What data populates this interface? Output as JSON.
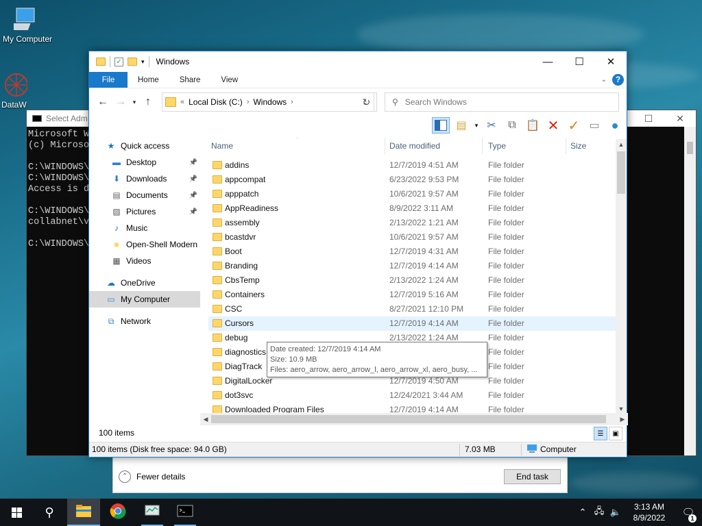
{
  "desktop": {
    "icons": [
      {
        "label": "My Computer",
        "icon": "computer-icon"
      },
      {
        "label": "DataW",
        "icon": "datawarehouse-icon"
      }
    ]
  },
  "cmd": {
    "title": "Select Adm",
    "lines": [
      "Microsoft W",
      "(c) Microso",
      "",
      "C:\\WINDOWS\\:",
      "C:\\WINDOWS\\:",
      "Access is de",
      "",
      "C:\\WINDOWS\\:",
      "collabnet\\v",
      "",
      "C:\\WINDOWS\\:"
    ]
  },
  "taskmgr": {
    "fewer_details": "Fewer details",
    "end_task": "End task"
  },
  "explorer": {
    "title": "Windows",
    "ribbon_tabs": [
      "File",
      "Home",
      "Share",
      "View"
    ],
    "address": {
      "root": "Local Disk (C:)",
      "current": "Windows",
      "prefix": "«"
    },
    "search_placeholder": "Search Windows",
    "columns": {
      "name": "Name",
      "date": "Date modified",
      "type": "Type",
      "size": "Size"
    },
    "nav": [
      {
        "label": "Quick access",
        "level": 0,
        "icon": "star-icon"
      },
      {
        "label": "Desktop",
        "level": 1,
        "icon": "desktop-icon",
        "pinned": true
      },
      {
        "label": "Downloads",
        "level": 1,
        "icon": "download-icon",
        "pinned": true
      },
      {
        "label": "Documents",
        "level": 1,
        "icon": "document-icon",
        "pinned": true
      },
      {
        "label": "Pictures",
        "level": 1,
        "icon": "pictures-icon",
        "pinned": true
      },
      {
        "label": "Music",
        "level": 1,
        "icon": "music-icon"
      },
      {
        "label": "Open-Shell Modern",
        "level": 1,
        "icon": "folder-icon"
      },
      {
        "label": "Videos",
        "level": 1,
        "icon": "video-icon"
      },
      {
        "label": "OneDrive",
        "level": 0,
        "icon": "cloud-icon"
      },
      {
        "label": "My Computer",
        "level": 0,
        "icon": "computer-icon",
        "selected": true
      },
      {
        "label": "Network",
        "level": 0,
        "icon": "network-icon"
      }
    ],
    "files": [
      {
        "name": "addins",
        "date": "12/7/2019 4:51 AM",
        "type": "File folder"
      },
      {
        "name": "appcompat",
        "date": "6/23/2022 9:53 PM",
        "type": "File folder"
      },
      {
        "name": "apppatch",
        "date": "10/6/2021 9:57 AM",
        "type": "File folder"
      },
      {
        "name": "AppReadiness",
        "date": "8/9/2022 3:11 AM",
        "type": "File folder"
      },
      {
        "name": "assembly",
        "date": "2/13/2022 1:21 AM",
        "type": "File folder"
      },
      {
        "name": "bcastdvr",
        "date": "10/6/2021 9:57 AM",
        "type": "File folder"
      },
      {
        "name": "Boot",
        "date": "12/7/2019 4:31 AM",
        "type": "File folder"
      },
      {
        "name": "Branding",
        "date": "12/7/2019 4:14 AM",
        "type": "File folder"
      },
      {
        "name": "CbsTemp",
        "date": "2/13/2022 1:24 AM",
        "type": "File folder"
      },
      {
        "name": "Containers",
        "date": "12/7/2019 5:16 AM",
        "type": "File folder"
      },
      {
        "name": "CSC",
        "date": "8/27/2021 12:10 PM",
        "type": "File folder"
      },
      {
        "name": "Cursors",
        "date": "12/7/2019 4:14 AM",
        "type": "File folder",
        "hover": true
      },
      {
        "name": "debug",
        "date": "2/13/2022 1:24 AM",
        "type": "File folder"
      },
      {
        "name": "diagnostics",
        "date": "",
        "type": "File folder"
      },
      {
        "name": "DiagTrack",
        "date": "",
        "type": "File folder"
      },
      {
        "name": "DigitalLocker",
        "date": "12/7/2019 4:50 AM",
        "type": "File folder"
      },
      {
        "name": "dot3svc",
        "date": "12/24/2021 3:44 AM",
        "type": "File folder"
      },
      {
        "name": "Downloaded Program Files",
        "date": "12/7/2019 4:14 AM",
        "type": "File folder"
      }
    ],
    "tooltip": {
      "created": "Date created: 12/7/2019 4:14 AM",
      "size": "Size: 10.9 MB",
      "files": "Files: aero_arrow, aero_arrow_l, aero_arrow_xl, aero_busy, ..."
    },
    "item_count": "100 items",
    "status": {
      "left": "100 items (Disk free space: 94.0 GB)",
      "size": "7.03 MB",
      "location": "Computer"
    }
  },
  "taskbar": {
    "time": "3:13 AM",
    "date": "8/9/2022",
    "notifications": "1"
  },
  "colors": {
    "accent": "#1979ca",
    "folder": "#ffd769",
    "taskbar": "#101418"
  }
}
